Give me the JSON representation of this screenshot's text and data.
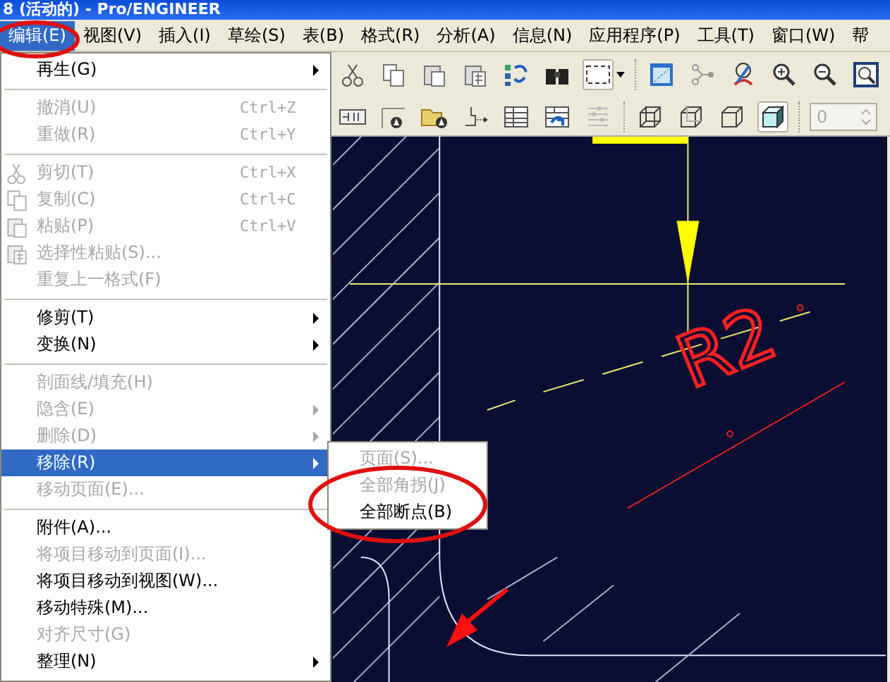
{
  "window": {
    "title": "8 (活动的) - Pro/ENGINEER"
  },
  "menubar": [
    {
      "label": "编辑(E)",
      "selected": true
    },
    {
      "label": "视图(V)",
      "selected": false
    },
    {
      "label": "插入(I)",
      "selected": false
    },
    {
      "label": "草绘(S)",
      "selected": false
    },
    {
      "label": "表(B)",
      "selected": false
    },
    {
      "label": "格式(R)",
      "selected": false
    },
    {
      "label": "分析(A)",
      "selected": false
    },
    {
      "label": "信息(N)",
      "selected": false
    },
    {
      "label": "应用程序(P)",
      "selected": false
    },
    {
      "label": "工具(T)",
      "selected": false
    },
    {
      "label": "窗口(W)",
      "selected": false
    },
    {
      "label": "帮",
      "selected": false
    }
  ],
  "menu": {
    "items": [
      {
        "kind": "item",
        "label": "再生(G)",
        "disabled": false,
        "selected": false,
        "submenu": true
      },
      {
        "kind": "separator"
      },
      {
        "kind": "item",
        "label": "撤消(U)",
        "shortcut": "Ctrl+Z",
        "disabled": true,
        "selected": false,
        "submenu": false
      },
      {
        "kind": "item",
        "label": "重做(R)",
        "shortcut": "Ctrl+Y",
        "disabled": true,
        "selected": false,
        "submenu": false
      },
      {
        "kind": "separator"
      },
      {
        "kind": "icon_item",
        "label": "剪切(T)",
        "shortcut": "Ctrl+X",
        "disabled": true,
        "selected": false,
        "submenu": false
      },
      {
        "kind": "icon_item",
        "label": "复制(C)",
        "shortcut": "Ctrl+C",
        "disabled": true,
        "selected": false,
        "submenu": false
      },
      {
        "kind": "icon_item",
        "label": "粘贴(P)",
        "shortcut": "Ctrl+V",
        "disabled": true,
        "selected": false,
        "submenu": false
      },
      {
        "kind": "icon_item",
        "label": "选择性粘贴(S)...",
        "disabled": true,
        "selected": false,
        "submenu": false
      },
      {
        "kind": "item",
        "label": "重复上一格式(F)",
        "disabled": true,
        "selected": false,
        "submenu": false
      },
      {
        "kind": "separator"
      },
      {
        "kind": "item",
        "label": "修剪(T)",
        "disabled": false,
        "selected": false,
        "submenu": true
      },
      {
        "kind": "item",
        "label": "变换(N)",
        "disabled": false,
        "selected": false,
        "submenu": true
      },
      {
        "kind": "separator"
      },
      {
        "kind": "item",
        "label": "剖面线/填充(H)",
        "disabled": true,
        "selected": false,
        "submenu": false
      },
      {
        "kind": "item",
        "label": "隐含(E)",
        "disabled": true,
        "selected": false,
        "submenu": true
      },
      {
        "kind": "item",
        "label": "删除(D)",
        "disabled": true,
        "selected": false,
        "submenu": true
      },
      {
        "kind": "item",
        "label": "移除(R)",
        "disabled": false,
        "selected": true,
        "submenu": true
      },
      {
        "kind": "item",
        "label": "移动页面(E)...",
        "disabled": true,
        "selected": false,
        "submenu": false
      },
      {
        "kind": "separator"
      },
      {
        "kind": "item",
        "label": "附件(A)...",
        "disabled": false,
        "selected": false,
        "submenu": false
      },
      {
        "kind": "item",
        "label": "将项目移动到页面(I)...",
        "disabled": true,
        "selected": false,
        "submenu": false
      },
      {
        "kind": "item",
        "label": "将项目移动到视图(W)...",
        "disabled": false,
        "selected": false,
        "submenu": false
      },
      {
        "kind": "item",
        "label": "移动特殊(M)...",
        "disabled": false,
        "selected": false,
        "submenu": false
      },
      {
        "kind": "item",
        "label": "对齐尺寸(G)",
        "disabled": true,
        "selected": false,
        "submenu": false
      },
      {
        "kind": "item",
        "label": "整理(N)",
        "disabled": false,
        "selected": false,
        "submenu": true
      }
    ]
  },
  "submenu": {
    "items": [
      {
        "label": "页面(S)...",
        "disabled": true
      },
      {
        "label": "全部角拐(J)",
        "disabled": true
      },
      {
        "label": "全部断点(B)",
        "disabled": false
      }
    ]
  },
  "toolbar_top": [
    {
      "pressed": false
    },
    {
      "pressed": false
    },
    {
      "pressed": false
    },
    {
      "pressed": false
    },
    {
      "pressed": false
    },
    {
      "pressed": false
    },
    {
      "pressed": true
    },
    {
      "pressed": false
    },
    {
      "pressed": false
    },
    {
      "pressed": false
    },
    {
      "pressed": false
    },
    {
      "pressed": false
    },
    {
      "pressed": false
    }
  ],
  "toolbar_bottom": [
    {
      "pressed": false
    },
    {
      "pressed": false
    },
    {
      "pressed": false
    },
    {
      "pressed": false
    },
    {
      "pressed": false
    },
    {
      "pressed": false
    },
    {
      "pressed": false
    },
    {
      "pressed": false
    },
    {
      "pressed": false
    },
    {
      "pressed": false
    },
    {
      "pressed": true
    }
  ],
  "spinner": {
    "value": "0",
    "disabled": true
  },
  "drawing": {
    "dimension_label": "R2"
  }
}
